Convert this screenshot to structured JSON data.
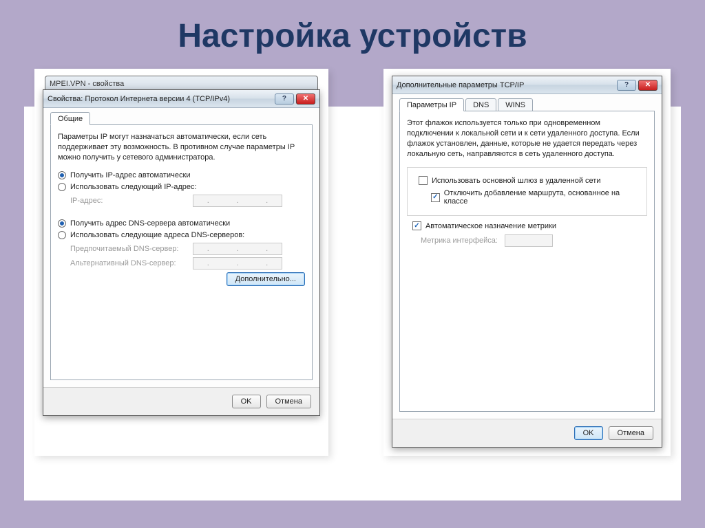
{
  "page": {
    "title": "Настройка устройств"
  },
  "left": {
    "back_title": "MPEI.VPN - свойства",
    "title": "Свойства: Протокол Интернета версии 4 (TCP/IPv4)",
    "tab_general": "Общие",
    "desc": "Параметры IP могут назначаться автоматически, если сеть поддерживает эту возможность. В противном случае параметры IP можно получить у сетевого администратора.",
    "r_ip_auto": "Получить IP-адрес автоматически",
    "r_ip_manual": "Использовать следующий IP-адрес:",
    "lbl_ip": "IP-адрес:",
    "r_dns_auto": "Получить адрес DNS-сервера автоматически",
    "r_dns_manual": "Использовать следующие адреса DNS-серверов:",
    "lbl_dns_pref": "Предпочитаемый DNS-сервер:",
    "lbl_dns_alt": "Альтернативный DNS-сервер:",
    "btn_advanced": "Дополнительно...",
    "btn_ok": "OK",
    "btn_cancel": "Отмена"
  },
  "right": {
    "title": "Дополнительные параметры TCP/IP",
    "tabs": {
      "ip": "Параметры IP",
      "dns": "DNS",
      "wins": "WINS"
    },
    "desc": "Этот флажок используется только при одновременном подключении к локальной сети и к сети удаленного доступа. Если флажок установлен, данные, которые не удается передать через локальную сеть, направляются в сеть удаленного доступа.",
    "chk_gateway": "Использовать основной шлюз в удаленной сети",
    "chk_route": "Отключить добавление маршрута, основанное на классе",
    "chk_metric": "Автоматическое назначение метрики",
    "lbl_metric": "Метрика интерфейса:",
    "btn_ok": "OK",
    "btn_cancel": "Отмена"
  }
}
